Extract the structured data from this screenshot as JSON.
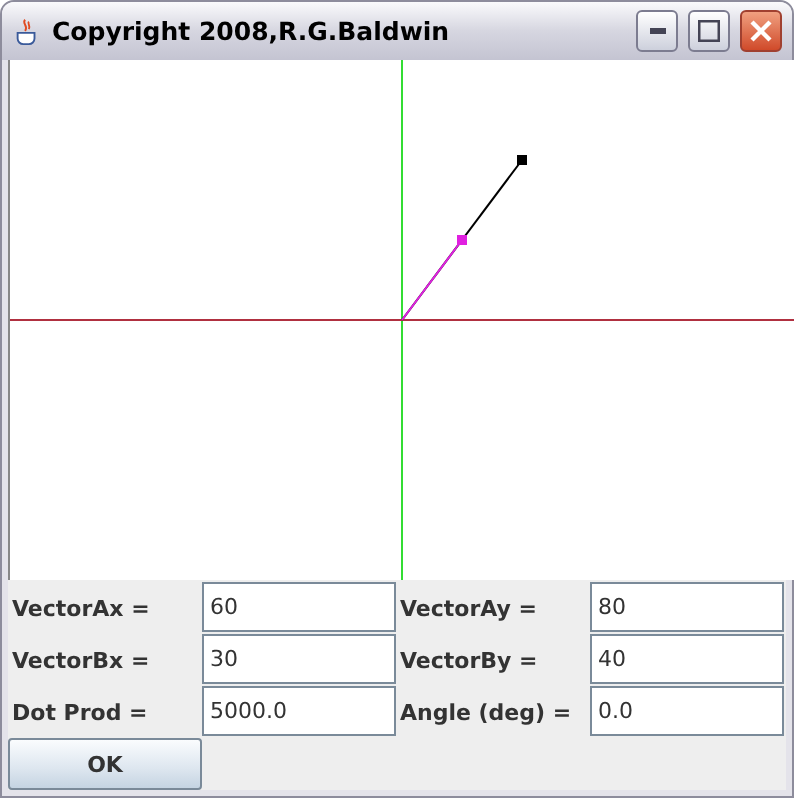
{
  "window": {
    "title": "Copyright  2008,R.G.Baldwin"
  },
  "fields": [
    {
      "label": "VectorAx =",
      "value": "60"
    },
    {
      "label": "VectorAy =",
      "value": "80"
    },
    {
      "label": "VectorBx =",
      "value": "30"
    },
    {
      "label": "VectorBy =",
      "value": "40"
    },
    {
      "label": "Dot Prod =",
      "value": "5000.0"
    },
    {
      "label": "Angle (deg) =",
      "value": "0.0"
    }
  ],
  "buttons": [
    "OK"
  ]
}
